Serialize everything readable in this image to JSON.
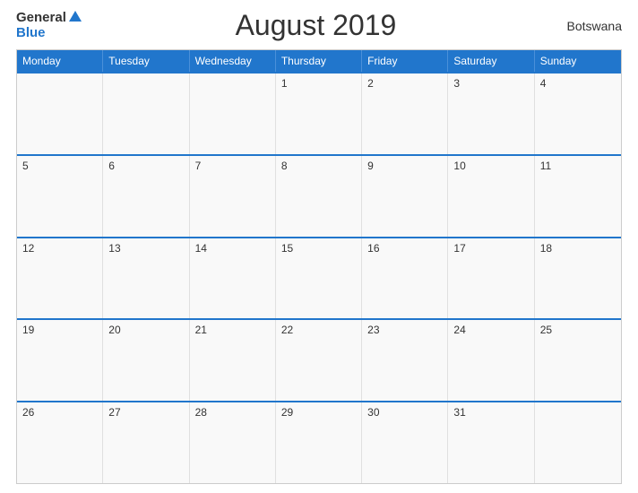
{
  "header": {
    "logo": {
      "general": "General",
      "blue": "Blue",
      "triangle": true
    },
    "title": "August 2019",
    "country": "Botswana"
  },
  "dayHeaders": [
    "Monday",
    "Tuesday",
    "Wednesday",
    "Thursday",
    "Friday",
    "Saturday",
    "Sunday"
  ],
  "weeks": [
    [
      {
        "day": "",
        "empty": true
      },
      {
        "day": "",
        "empty": true
      },
      {
        "day": "",
        "empty": true
      },
      {
        "day": "1",
        "empty": false
      },
      {
        "day": "2",
        "empty": false
      },
      {
        "day": "3",
        "empty": false
      },
      {
        "day": "4",
        "empty": false
      }
    ],
    [
      {
        "day": "5",
        "empty": false
      },
      {
        "day": "6",
        "empty": false
      },
      {
        "day": "7",
        "empty": false
      },
      {
        "day": "8",
        "empty": false
      },
      {
        "day": "9",
        "empty": false
      },
      {
        "day": "10",
        "empty": false
      },
      {
        "day": "11",
        "empty": false
      }
    ],
    [
      {
        "day": "12",
        "empty": false
      },
      {
        "day": "13",
        "empty": false
      },
      {
        "day": "14",
        "empty": false
      },
      {
        "day": "15",
        "empty": false
      },
      {
        "day": "16",
        "empty": false
      },
      {
        "day": "17",
        "empty": false
      },
      {
        "day": "18",
        "empty": false
      }
    ],
    [
      {
        "day": "19",
        "empty": false
      },
      {
        "day": "20",
        "empty": false
      },
      {
        "day": "21",
        "empty": false
      },
      {
        "day": "22",
        "empty": false
      },
      {
        "day": "23",
        "empty": false
      },
      {
        "day": "24",
        "empty": false
      },
      {
        "day": "25",
        "empty": false
      }
    ],
    [
      {
        "day": "26",
        "empty": false
      },
      {
        "day": "27",
        "empty": false
      },
      {
        "day": "28",
        "empty": false
      },
      {
        "day": "29",
        "empty": false
      },
      {
        "day": "30",
        "empty": false
      },
      {
        "day": "31",
        "empty": false
      },
      {
        "day": "",
        "empty": true
      }
    ]
  ]
}
